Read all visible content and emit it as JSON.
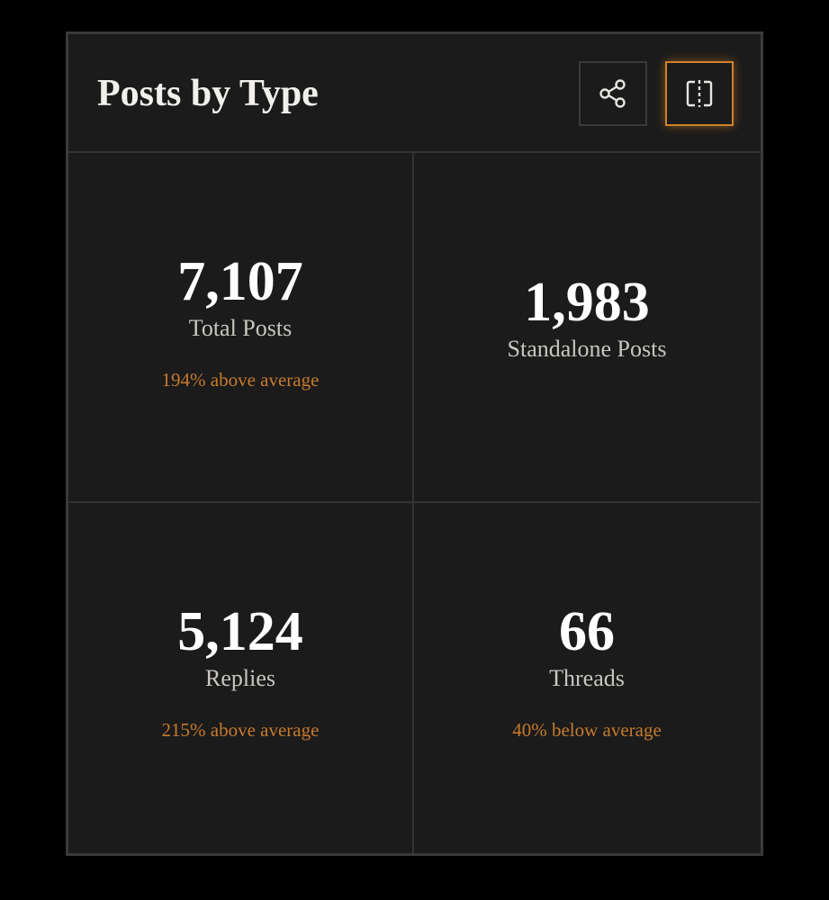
{
  "card": {
    "title": "Posts by Type",
    "actions": {
      "share_icon": "share-icon",
      "split_icon": "split-view-icon"
    }
  },
  "stats": [
    {
      "value": "7,107",
      "label": "Total Posts",
      "delta": "194% above average"
    },
    {
      "value": "1,983",
      "label": "Standalone Posts",
      "delta": ""
    },
    {
      "value": "5,124",
      "label": "Replies",
      "delta": "215% above average"
    },
    {
      "value": "66",
      "label": "Threads",
      "delta": "40% below average"
    }
  ],
  "colors": {
    "background": "#000000",
    "card": "#1b1b1b",
    "border": "#3a3a3a",
    "accent": "#d0822a",
    "delta_text": "#c77a2c"
  }
}
